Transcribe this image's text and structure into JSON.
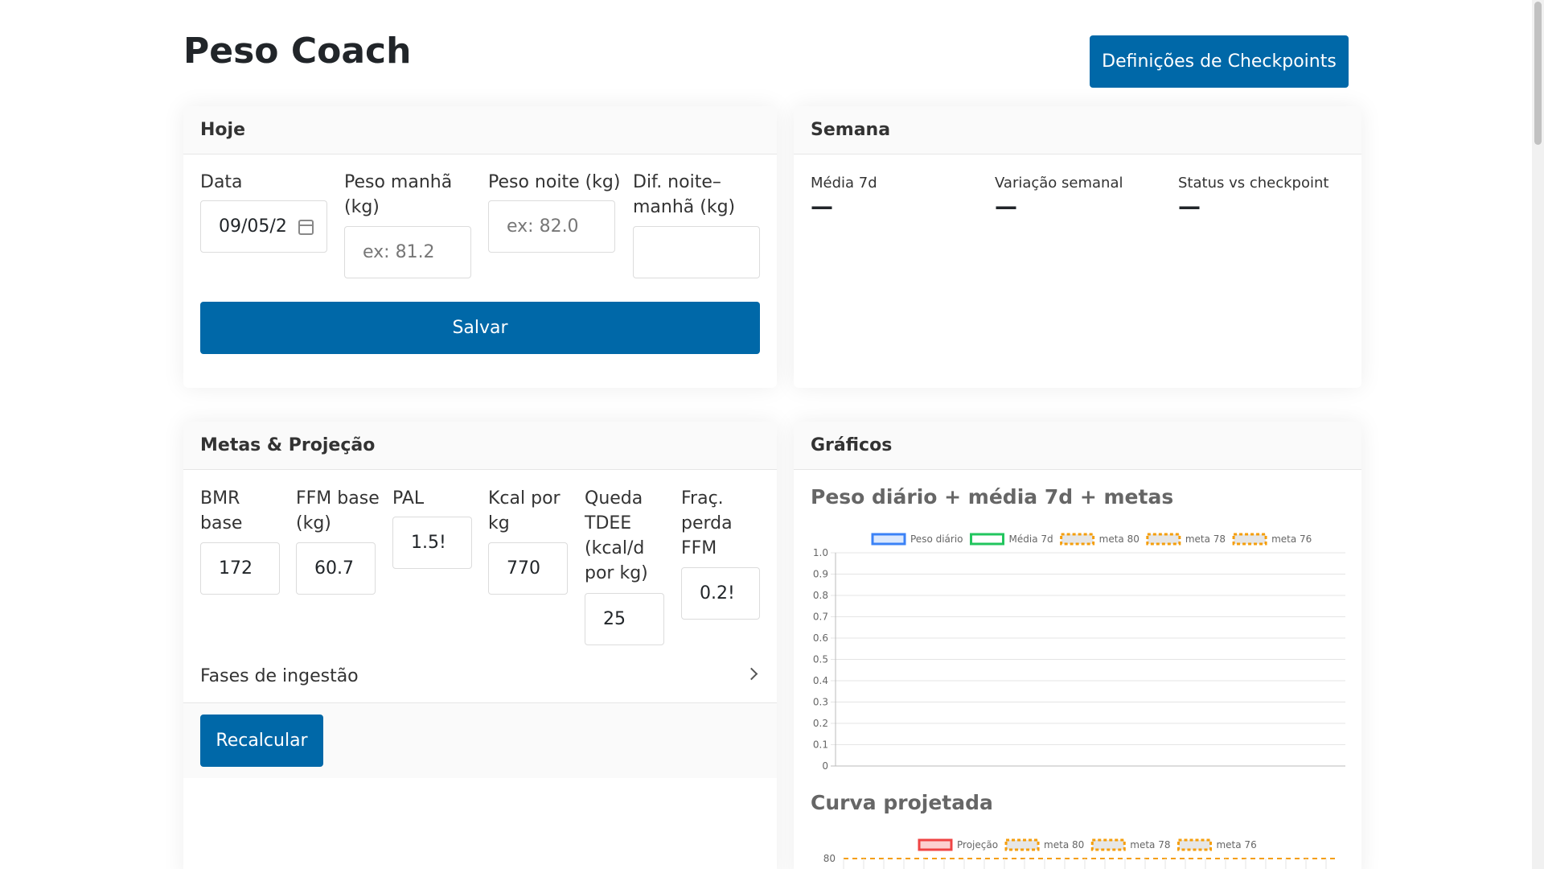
{
  "app": {
    "title": "Peso Coach",
    "checkpoint_button": "Definições de Checkpoints"
  },
  "hoje": {
    "title": "Hoje",
    "data_label": "Data",
    "data_value": "09/05/2",
    "peso_manha_label": "Peso manhã (kg)",
    "peso_manha_placeholder": "ex: 81.2",
    "peso_noite_label": "Peso noite (kg)",
    "peso_noite_placeholder": "ex: 82.0",
    "dif_label": "Dif. noite–manhã (kg)",
    "dif_value": "",
    "save_button": "Salvar"
  },
  "semana": {
    "title": "Semana",
    "kpis": [
      {
        "label": "Média 7d",
        "value": "—"
      },
      {
        "label": "Variação semanal",
        "value": "—"
      },
      {
        "label": "Status vs checkpoint",
        "value": "—"
      }
    ]
  },
  "metas": {
    "title": "Metas & Projeção",
    "fields": [
      {
        "label": "BMR base",
        "value": "172"
      },
      {
        "label": "FFM base (kg)",
        "value": "60.7"
      },
      {
        "label": "PAL",
        "value": "1.5!"
      },
      {
        "label": "Kcal por kg",
        "value": "770"
      },
      {
        "label": "Queda TDEE (kcal/d por kg)",
        "value": "25"
      },
      {
        "label": "Fraç. perda FFM",
        "value": "0.2!"
      }
    ],
    "fases_label": "Fases de ingestão",
    "recalc_button": "Recalcular"
  },
  "graficos": {
    "title": "Gráficos",
    "chart1_title": "Peso diário + média 7d + metas",
    "chart2_title": "Curva projetada"
  },
  "colors": {
    "primary": "#0068a8",
    "peso_diario": "#3b82f6",
    "media_7d": "#22c55e",
    "meta": "#f59e0b",
    "projecao": "#ef4444"
  },
  "chart_data": [
    {
      "type": "line",
      "title": "Peso diário + média 7d + metas",
      "series": [
        {
          "name": "Peso diário",
          "values": []
        },
        {
          "name": "Média 7d",
          "values": []
        },
        {
          "name": "meta 80",
          "values": []
        },
        {
          "name": "meta 78",
          "values": []
        },
        {
          "name": "meta 76",
          "values": []
        }
      ],
      "yticks": [
        "0",
        "0.1",
        "0.2",
        "0.3",
        "0.4",
        "0.5",
        "0.6",
        "0.7",
        "0.8",
        "0.9",
        "1.0"
      ],
      "ylim": [
        0,
        1.0
      ],
      "grid": true,
      "legend": "top"
    },
    {
      "type": "line",
      "title": "Curva projetada",
      "series": [
        {
          "name": "Projeção",
          "values": []
        },
        {
          "name": "meta 80",
          "values": []
        },
        {
          "name": "meta 78",
          "values": []
        },
        {
          "name": "meta 76",
          "values": []
        }
      ],
      "yticks": [
        "80"
      ],
      "grid": true,
      "legend": "top"
    }
  ]
}
